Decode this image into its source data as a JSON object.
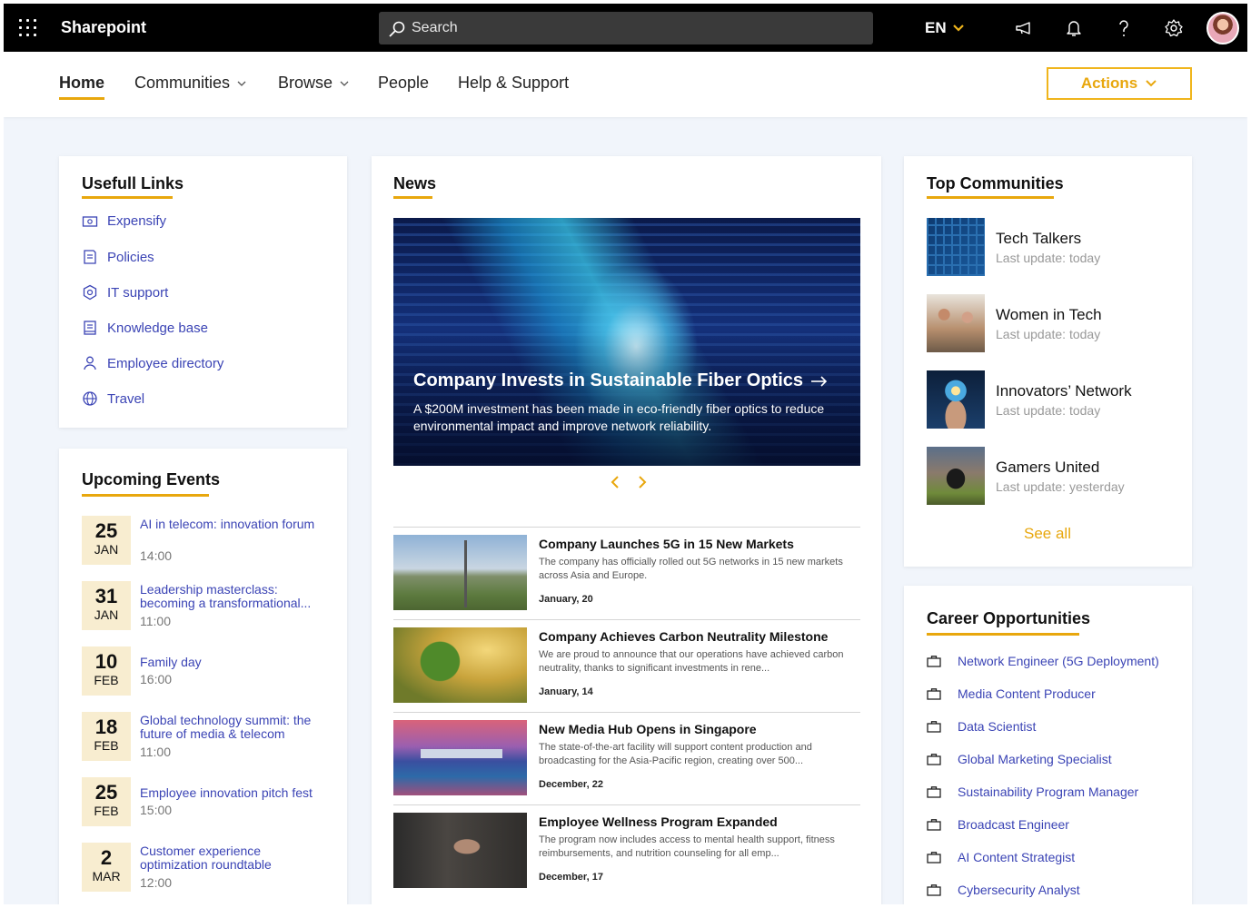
{
  "header": {
    "app_title": "Sharepoint",
    "search_placeholder": "Search",
    "language": "EN"
  },
  "nav": {
    "items": [
      {
        "label": "Home"
      },
      {
        "label": "Communities"
      },
      {
        "label": "Browse"
      },
      {
        "label": "People"
      },
      {
        "label": "Help & Support"
      }
    ],
    "actions_label": "Actions"
  },
  "useful_links": {
    "title": "Usefull Links",
    "items": [
      {
        "label": "Expensify",
        "icon": "money-icon"
      },
      {
        "label": "Policies",
        "icon": "document-icon"
      },
      {
        "label": "IT support",
        "icon": "shield-icon"
      },
      {
        "label": "Knowledge base",
        "icon": "book-icon"
      },
      {
        "label": "Employee directory",
        "icon": "person-icon"
      },
      {
        "label": "Travel",
        "icon": "globe-icon"
      }
    ]
  },
  "events": {
    "title": "Upcoming Events",
    "items": [
      {
        "day": "25",
        "month": "JAN",
        "title": "AI in telecom: innovation forum",
        "time": "14:00"
      },
      {
        "day": "31",
        "month": "JAN",
        "title": "Leadership masterclass: becoming a transformational...",
        "time": "11:00"
      },
      {
        "day": "10",
        "month": "FEB",
        "title": "Family day",
        "time": "16:00"
      },
      {
        "day": "18",
        "month": "FEB",
        "title": "Global technology summit: the future of media & telecom",
        "time": "11:00"
      },
      {
        "day": "25",
        "month": "FEB",
        "title": "Employee innovation pitch fest",
        "time": "15:00"
      },
      {
        "day": "2",
        "month": "MAR",
        "title": "Customer experience optimization roundtable",
        "time": "12:00"
      }
    ]
  },
  "news": {
    "title": "News",
    "hero": {
      "title": "Company Invests in Sustainable Fiber Optics",
      "description": "A $200M investment has been made in eco-friendly fiber optics to reduce environmental impact and improve network reliability."
    },
    "items": [
      {
        "title": "Company Launches 5G in 15 New Markets",
        "description": "The company has officially rolled out 5G networks in 15 new markets across Asia and Europe.",
        "date": "January, 20"
      },
      {
        "title": "Company Achieves Carbon Neutrality Milestone",
        "description": "We are proud to announce that our operations have achieved carbon neutrality, thanks to significant investments in rene...",
        "date": "January, 14"
      },
      {
        "title": "New Media Hub Opens in Singapore",
        "description": "The state-of-the-art facility will support content production and broadcasting for the Asia-Pacific region, creating over 500...",
        "date": "December, 22"
      },
      {
        "title": "Employee Wellness Program Expanded",
        "description": "The program now includes access to mental health support, fitness reimbursements, and nutrition counseling for all emp...",
        "date": "December, 17"
      }
    ]
  },
  "communities": {
    "title": "Top Communities",
    "items": [
      {
        "name": "Tech Talkers",
        "update": "Last update: today"
      },
      {
        "name": "Women in Tech",
        "update": "Last update: today"
      },
      {
        "name": "Innovators’ Network",
        "update": "Last update: today"
      },
      {
        "name": "Gamers United",
        "update": "Last update: yesterday"
      }
    ],
    "see_all": "See all"
  },
  "careers": {
    "title": "Career Opportunities",
    "items": [
      {
        "label": "Network Engineer (5G Deployment)"
      },
      {
        "label": "Media Content Producer"
      },
      {
        "label": "Data Scientist"
      },
      {
        "label": "Global Marketing Specialist"
      },
      {
        "label": "Sustainability Program Manager"
      },
      {
        "label": "Broadcast Engineer"
      },
      {
        "label": "AI Content Strategist"
      },
      {
        "label": "Cybersecurity Analyst"
      }
    ]
  },
  "colors": {
    "accent": "#e8a70d",
    "link": "#3b44b5",
    "topbar": "#000000",
    "background": "#f1f5fb"
  }
}
